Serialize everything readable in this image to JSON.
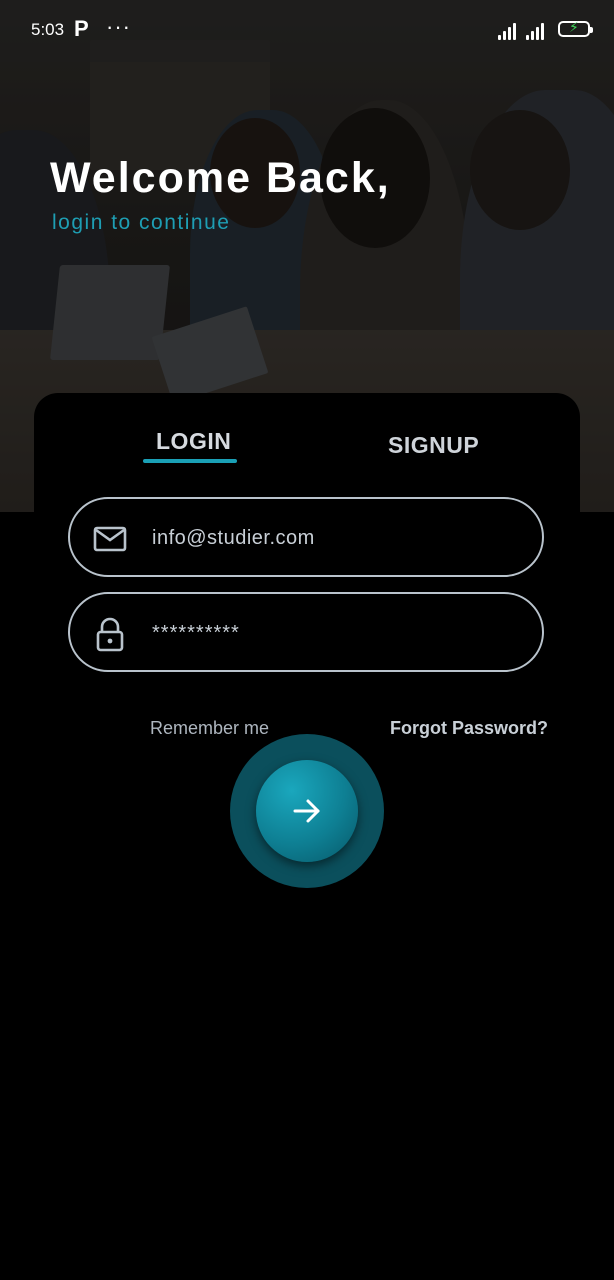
{
  "status_bar": {
    "time": "5:03",
    "app_icon": "P",
    "more": "···",
    "battery_icon": "battery-charging-icon"
  },
  "header": {
    "title": "Welcome Back,",
    "subtitle": "login to continue"
  },
  "tabs": {
    "login": "LOGIN",
    "signup": "SIGNUP",
    "active": "LOGIN"
  },
  "form": {
    "email_value": "info@studier.com",
    "password_value": "**********",
    "remember_label": "Remember me",
    "forgot_label": "Forgot Password?"
  },
  "colors": {
    "accent": "#1aa0b6",
    "background": "#000000",
    "field_border": "#b9c3cc",
    "button_ring": "#0b4f5c"
  },
  "icons": {
    "email": "mail-icon",
    "password": "lock-icon",
    "submit": "arrow-right-icon"
  }
}
